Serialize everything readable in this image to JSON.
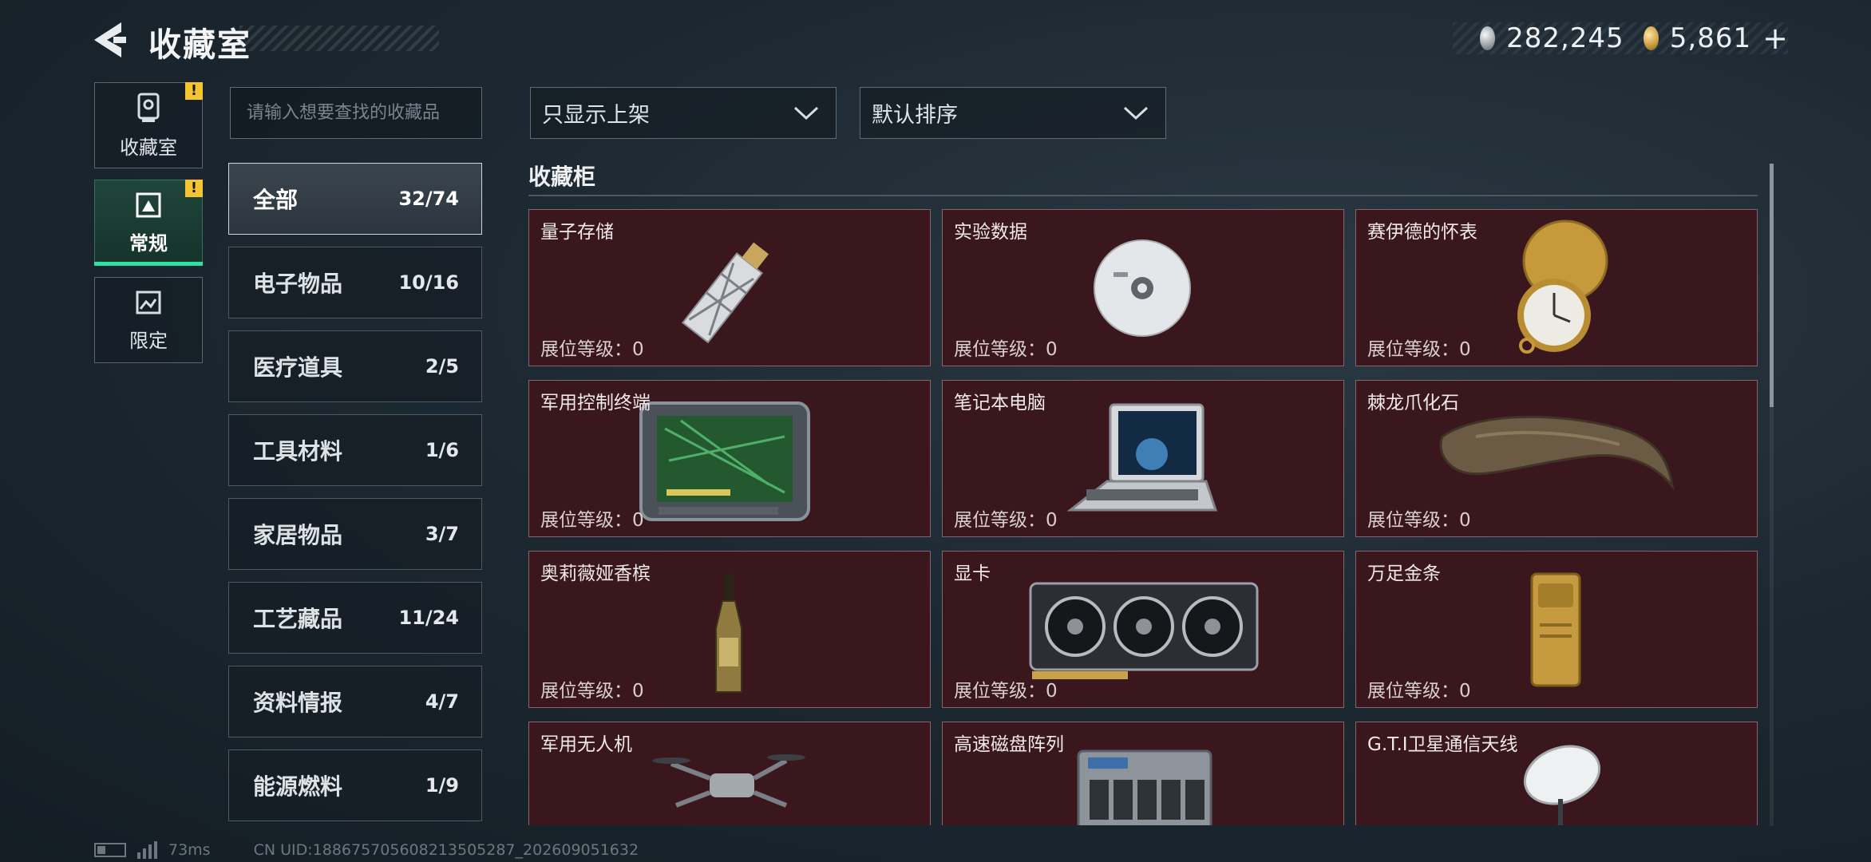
{
  "header": {
    "title": "收藏室"
  },
  "currency": {
    "silver": "282,245",
    "gold": "5,861",
    "add_label": "+"
  },
  "nav_tabs": [
    {
      "label": "收藏室",
      "icon": "trophy-icon",
      "badge": "!"
    },
    {
      "label": "常规",
      "icon": "display-case-icon",
      "badge": "!"
    },
    {
      "label": "限定",
      "icon": "image-icon"
    }
  ],
  "search": {
    "placeholder": "请输入想要查找的收藏品",
    "value": ""
  },
  "filters": {
    "display_filter": "只显示上架",
    "sort": "默认排序"
  },
  "categories": [
    {
      "name": "全部",
      "count": "32/74"
    },
    {
      "name": "电子物品",
      "count": "10/16"
    },
    {
      "name": "医疗道具",
      "count": "2/5"
    },
    {
      "name": "工具材料",
      "count": "1/6"
    },
    {
      "name": "家居物品",
      "count": "3/7"
    },
    {
      "name": "工艺藏品",
      "count": "11/24"
    },
    {
      "name": "资料情报",
      "count": "4/7"
    },
    {
      "name": "能源燃料",
      "count": "1/9"
    }
  ],
  "showcase": {
    "title": "收藏柜",
    "items": [
      {
        "name": "量子存储",
        "level": "展位等级：0",
        "icon": "usb-drive-icon"
      },
      {
        "name": "实验数据",
        "level": "展位等级：0",
        "icon": "disc-icon"
      },
      {
        "name": "赛伊德的怀表",
        "level": "展位等级：0",
        "icon": "pocket-watch-icon"
      },
      {
        "name": "军用控制终端",
        "level": "展位等级：0",
        "icon": "control-terminal-icon"
      },
      {
        "name": "笔记本电脑",
        "level": "展位等级：0",
        "icon": "laptop-icon"
      },
      {
        "name": "棘龙爪化石",
        "level": "展位等级：0",
        "icon": "claw-fossil-icon"
      },
      {
        "name": "奥莉薇娅香槟",
        "level": "展位等级：0",
        "icon": "champagne-bottle-icon"
      },
      {
        "name": "显卡",
        "level": "展位等级：0",
        "icon": "graphics-card-icon"
      },
      {
        "name": "万足金条",
        "level": "展位等级：0",
        "icon": "gold-bar-icon"
      },
      {
        "name": "军用无人机",
        "level": "",
        "icon": "drone-icon"
      },
      {
        "name": "高速磁盘阵列",
        "level": "",
        "icon": "disk-array-icon"
      },
      {
        "name": "G.T.I卫星通信天线",
        "level": "",
        "icon": "satellite-dish-icon"
      }
    ]
  },
  "footer": {
    "ping": "73ms",
    "uid": "CN UID:1886757056082135052​87_202609051632"
  },
  "colors": {
    "accent": "#2ee2a5",
    "card_bg": "#3a171c",
    "warning": "#f4c531"
  }
}
